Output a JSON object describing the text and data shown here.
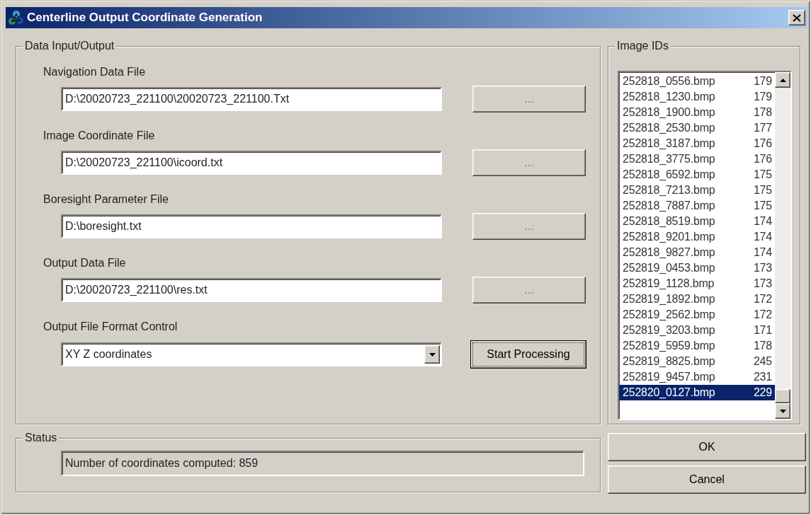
{
  "window": {
    "title": "Centerline Output Coordinate Generation"
  },
  "data_group": {
    "title": "Data Input/Output",
    "files": [
      {
        "label": "Navigation Data File",
        "value": "D:\\20020723_221100\\20020723_221100.Txt",
        "button": "..."
      },
      {
        "label": "Image Coordinate File",
        "value": "D:\\20020723_221100\\icoord.txt",
        "button": "..."
      },
      {
        "label": "Boresight Parameter File",
        "value": "D:\\boresight.txt",
        "button": "..."
      },
      {
        "label": "Output Data File",
        "value": "D:\\20020723_221100\\res.txt",
        "button": "..."
      }
    ],
    "format": {
      "label": "Output File Format Control",
      "value": "XY Z coordinates"
    },
    "start_button": "Start Processing"
  },
  "image_ids": {
    "title": "Image IDs",
    "items": [
      {
        "file": "252818_0556.bmp",
        "count": "179",
        "selected": false
      },
      {
        "file": "252818_1230.bmp",
        "count": "179",
        "selected": false
      },
      {
        "file": "252818_1900.bmp",
        "count": "178",
        "selected": false
      },
      {
        "file": "252818_2530.bmp",
        "count": "177",
        "selected": false
      },
      {
        "file": "252818_3187.bmp",
        "count": "176",
        "selected": false
      },
      {
        "file": "252818_3775.bmp",
        "count": "176",
        "selected": false
      },
      {
        "file": "252818_6592.bmp",
        "count": "175",
        "selected": false
      },
      {
        "file": "252818_7213.bmp",
        "count": "175",
        "selected": false
      },
      {
        "file": "252818_7887.bmp",
        "count": "175",
        "selected": false
      },
      {
        "file": "252818_8519.bmp",
        "count": "174",
        "selected": false
      },
      {
        "file": "252818_9201.bmp",
        "count": "174",
        "selected": false
      },
      {
        "file": "252818_9827.bmp",
        "count": "174",
        "selected": false
      },
      {
        "file": "252819_0453.bmp",
        "count": "173",
        "selected": false
      },
      {
        "file": "252819_1128.bmp",
        "count": "173",
        "selected": false
      },
      {
        "file": "252819_1892.bmp",
        "count": "172",
        "selected": false
      },
      {
        "file": "252819_2562.bmp",
        "count": "172",
        "selected": false
      },
      {
        "file": "252819_3203.bmp",
        "count": "171",
        "selected": false
      },
      {
        "file": "252819_5959.bmp",
        "count": "178",
        "selected": false
      },
      {
        "file": "252819_8825.bmp",
        "count": "245",
        "selected": false
      },
      {
        "file": "252819_9457.bmp",
        "count": "231",
        "selected": false
      },
      {
        "file": "252820_0127.bmp",
        "count": "229",
        "selected": true
      }
    ]
  },
  "status_group": {
    "title": "Status",
    "text": "Number of coordinates computed: 859"
  },
  "buttons": [
    "OK",
    "Cancel"
  ]
}
